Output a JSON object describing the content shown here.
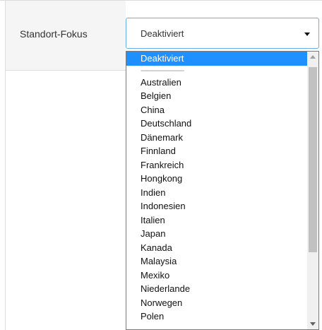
{
  "field": {
    "label": "Standort-Fokus",
    "selected_value": "Deaktiviert"
  },
  "dropdown": {
    "options": [
      "Deaktiviert",
      "-----------------------",
      "Australien",
      "Belgien",
      "China",
      "Deutschland",
      "Dänemark",
      "Finnland",
      "Frankreich",
      "Hongkong",
      "Indien",
      "Indonesien",
      "Italien",
      "Japan",
      "Kanada",
      "Malaysia",
      "Mexiko",
      "Niederlande",
      "Norwegen",
      "Polen"
    ],
    "highlighted_index": 0
  },
  "colors": {
    "highlight": "#1e90ff",
    "focus_border": "#66afe9"
  }
}
